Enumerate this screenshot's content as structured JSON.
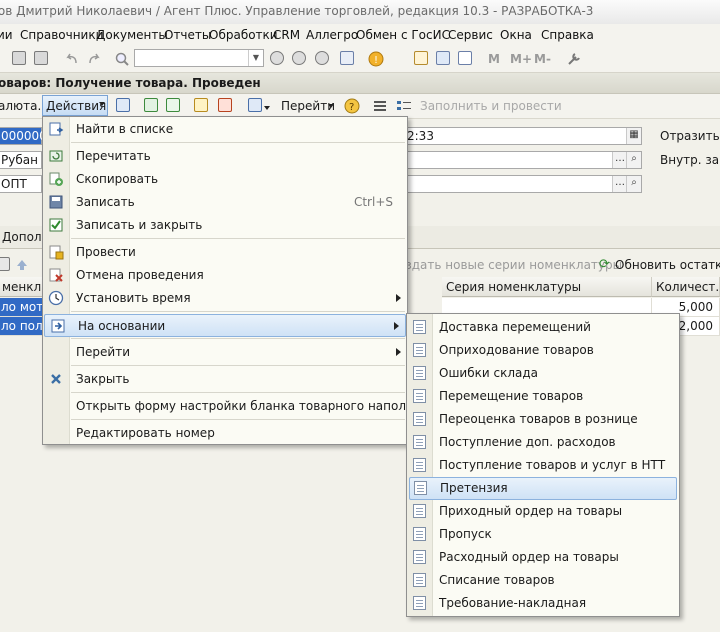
{
  "window": {
    "title": "нов Дмитрий Николаевич / Агент Плюс. Управление торговлей, редакция 10.3 - РАЗРАБОТКА-3"
  },
  "menubar": {
    "items": [
      "ии",
      "Справочники",
      "Документы",
      "Отчеты",
      "Обработки",
      "CRM",
      "Аллегро",
      "Обмен с ГосИС",
      "Сервис",
      "Окна",
      "Справка"
    ]
  },
  "toolbar": {
    "m_label": "M",
    "mplus_label": "M+",
    "mminus_label": "M-"
  },
  "document": {
    "title": "оваров: Получение товара. Проведен"
  },
  "doc_toolbar": {
    "currency": "алюта...",
    "actions": "Действия",
    "goto": "Перейти",
    "fill_and_post": "Заполнить и провести"
  },
  "form": {
    "number_value": "000000",
    "time_value": "2:33",
    "reflect_label": "Отразить в:",
    "person_value": "Рубан О.",
    "inner_label": "Внутр. зака",
    "price_value": "ОПТ",
    "tab_label": "Дополни",
    "create_series": "оздать новые серии номенклатуры",
    "refresh_stock": "Обновить остатки"
  },
  "table": {
    "headers": [
      "менклатура",
      "Серия номенклатуры",
      "Количест..."
    ],
    "rows": [
      {
        "name": "ло мото",
        "series": "",
        "qty": "5,000"
      },
      {
        "name": "ло полу",
        "series": "",
        "qty": "2,000"
      }
    ]
  },
  "actions_menu": {
    "items": [
      {
        "label": "Найти в списке",
        "icon": "find-in-list-icon"
      },
      {
        "label": "Перечитать",
        "icon": "reread-icon"
      },
      {
        "label": "Скопировать",
        "icon": "copy-icon"
      },
      {
        "label": "Записать",
        "shortcut": "Ctrl+S",
        "icon": "save-icon"
      },
      {
        "label": "Записать и закрыть",
        "icon": "save-close-icon"
      },
      {
        "label": "Провести",
        "icon": "post-icon"
      },
      {
        "label": "Отмена проведения",
        "icon": "unpost-icon"
      },
      {
        "label": "Установить время",
        "icon": "clock-icon"
      },
      {
        "label": "На основании",
        "icon": "based-on-icon"
      },
      {
        "label": "Перейти"
      },
      {
        "label": "Закрыть",
        "icon": "close-icon"
      },
      {
        "label": "Открыть форму настройки бланка товарного наполнения"
      },
      {
        "label": "Редактировать номер"
      }
    ]
  },
  "based_on_menu": {
    "items": [
      "Доставка перемещений",
      "Оприходование товаров",
      "Ошибки склада",
      "Перемещение товаров",
      "Переоценка товаров в рознице",
      "Поступление доп. расходов",
      "Поступление товаров и услуг в НТТ",
      "Претензия",
      "Приходный ордер на товары",
      "Пропуск",
      "Расходный ордер на товары",
      "Списание товаров",
      "Требование-накладная"
    ],
    "highlighted": "Претензия"
  },
  "colors": {
    "selection": "#316ac5",
    "menu_highlight": "#cfe2f6",
    "menu_bg": "#fbfbf4"
  }
}
